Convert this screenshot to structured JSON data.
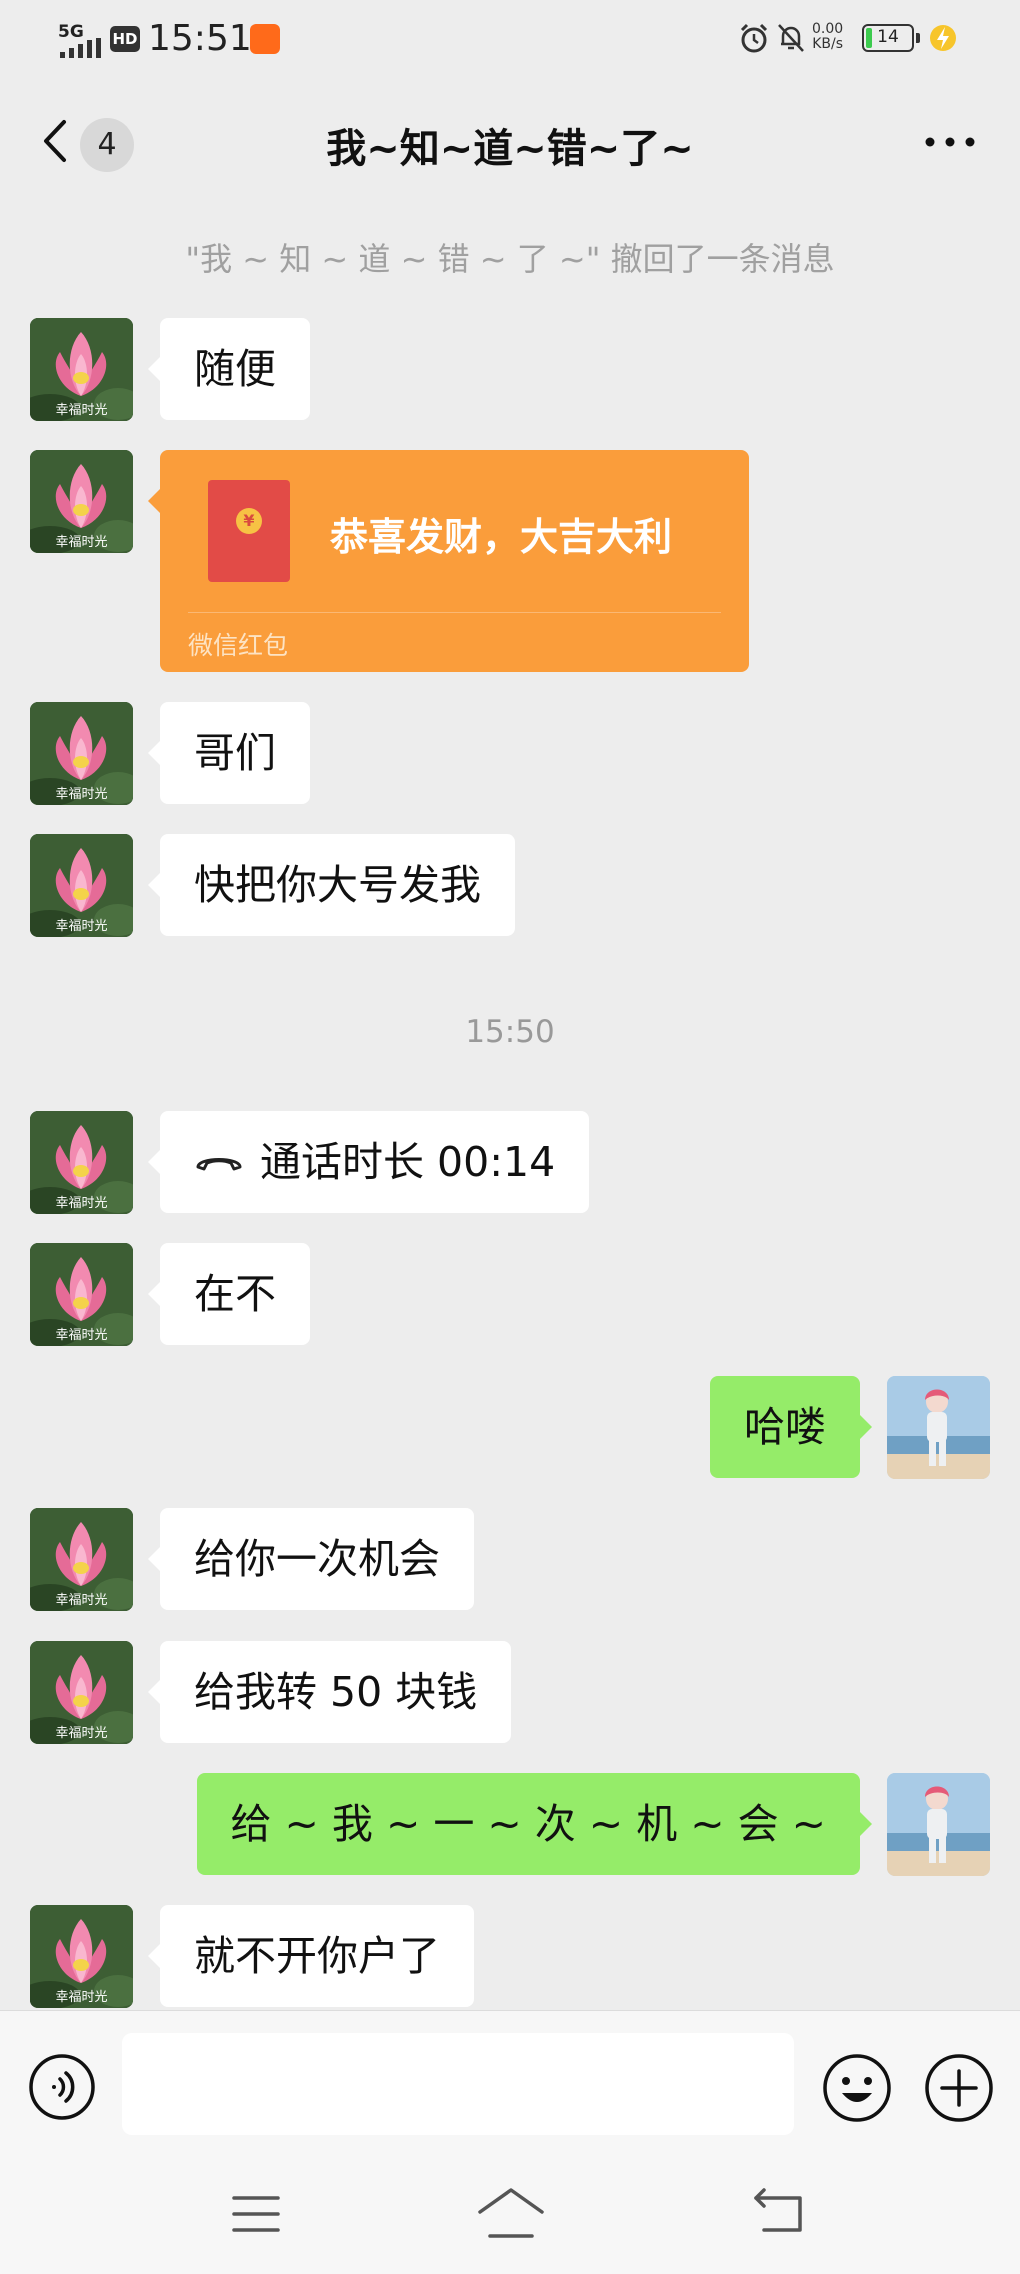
{
  "status_bar": {
    "network": "5G",
    "hd": "HD",
    "time": "15:51",
    "speed_value": "0.00",
    "speed_unit": "KB/s",
    "battery_level": "14",
    "battery_fraction": 0.14
  },
  "header": {
    "unread_count": "4",
    "title": "我~知~道~错~了~"
  },
  "messages": {
    "recall_notice": "\"我 ~ 知 ~ 道 ~ 错 ~ 了 ~\" 撤回了一条消息",
    "m1": "随便",
    "red_packet_title": "恭喜发财，大吉大利",
    "red_packet_label": "微信红包",
    "m2": "哥们",
    "m3": "快把你大号发我",
    "time_divider": "15:50",
    "call": "通话时长 00:14",
    "m4": "在不",
    "out1": "哈喽",
    "m5": "给你一次机会",
    "m6": "给我转 50 块钱",
    "out2": "给 ~ 我 ~ 一 ~ 次 ~ 机 ~ 会 ~",
    "m7": "就不开你户了"
  },
  "avatar_caption": "幸福时光",
  "input": {
    "value": ""
  },
  "colors": {
    "background": "#ededed",
    "bubble_incoming": "#ffffff",
    "bubble_outgoing": "#95ec69",
    "red_packet": "#fa9d3b",
    "battery_fill": "#3ccb4e"
  }
}
